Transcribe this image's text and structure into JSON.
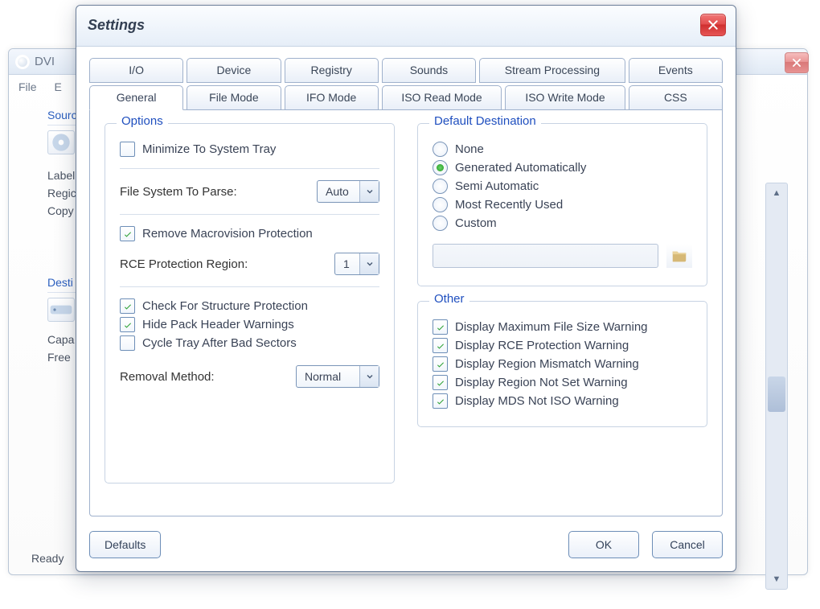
{
  "bg": {
    "title": "DVI",
    "menu": {
      "file": "File",
      "e": "E"
    },
    "source": {
      "title": "Sourc",
      "label": "Label",
      "region": "Regic",
      "copy": "Copy"
    },
    "dest": {
      "title": "Desti",
      "capa": "Capa",
      "free": "Free"
    },
    "status": "Ready"
  },
  "dialog": {
    "title": "Settings",
    "tabs_row1": [
      {
        "label": "I/O"
      },
      {
        "label": "Device"
      },
      {
        "label": "Registry"
      },
      {
        "label": "Sounds"
      },
      {
        "label": "Stream Processing"
      },
      {
        "label": "Events"
      }
    ],
    "tabs_row2": [
      {
        "label": "General",
        "active": true
      },
      {
        "label": "File Mode"
      },
      {
        "label": "IFO Mode"
      },
      {
        "label": "ISO Read Mode"
      },
      {
        "label": "ISO Write Mode"
      },
      {
        "label": "CSS"
      }
    ],
    "options": {
      "title": "Options",
      "minimize_tray": {
        "label": "Minimize To System Tray",
        "checked": false
      },
      "fs_parse_label": "File System To Parse:",
      "fs_parse_value": "Auto",
      "remove_macro": {
        "label": "Remove Macrovision Protection",
        "checked": true
      },
      "rce_region_label": "RCE Protection Region:",
      "rce_region_value": "1",
      "check_struct": {
        "label": "Check For Structure Protection",
        "checked": true
      },
      "hide_pack": {
        "label": "Hide Pack Header Warnings",
        "checked": true
      },
      "cycle_tray": {
        "label": "Cycle Tray After Bad Sectors",
        "checked": false
      },
      "removal_label": "Removal Method:",
      "removal_value": "Normal"
    },
    "default_dest": {
      "title": "Default Destination",
      "choices": [
        {
          "label": "None"
        },
        {
          "label": "Generated Automatically",
          "checked": true
        },
        {
          "label": "Semi Automatic"
        },
        {
          "label": "Most Recently Used"
        },
        {
          "label": "Custom"
        }
      ],
      "path": ""
    },
    "other": {
      "title": "Other",
      "items": [
        {
          "label": "Display Maximum File Size Warning",
          "checked": true
        },
        {
          "label": "Display RCE Protection Warning",
          "checked": true
        },
        {
          "label": "Display Region Mismatch Warning",
          "checked": true
        },
        {
          "label": "Display Region Not Set Warning",
          "checked": true
        },
        {
          "label": "Display MDS Not ISO Warning",
          "checked": true
        }
      ]
    },
    "buttons": {
      "defaults": "Defaults",
      "ok": "OK",
      "cancel": "Cancel"
    }
  }
}
